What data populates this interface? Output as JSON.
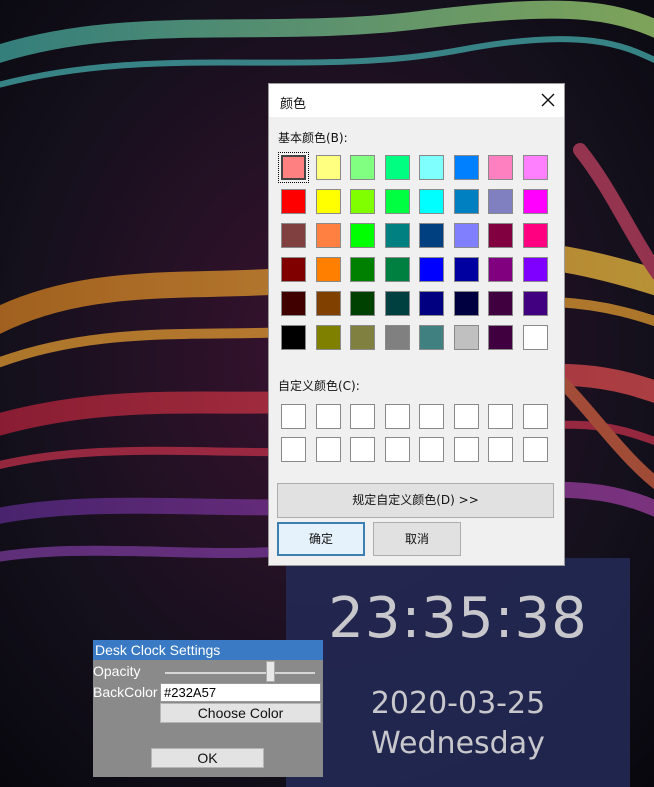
{
  "color_dialog": {
    "title": "颜色",
    "basic_colors_label": "基本颜色(B):",
    "custom_colors_label": "自定义颜色(C):",
    "define_custom_button": "规定自定义颜色(D) >>",
    "ok_button": "确定",
    "cancel_button": "取消",
    "basic_colors": [
      "#ff8080",
      "#ffff80",
      "#80ff80",
      "#00ff80",
      "#80ffff",
      "#0080ff",
      "#ff80c0",
      "#ff80ff",
      "#ff0000",
      "#ffff00",
      "#80ff00",
      "#00ff40",
      "#00ffff",
      "#0080c0",
      "#8080c0",
      "#ff00ff",
      "#804040",
      "#ff8040",
      "#00ff00",
      "#008080",
      "#004080",
      "#8080ff",
      "#800040",
      "#ff0080",
      "#800000",
      "#ff8000",
      "#008000",
      "#008040",
      "#0000ff",
      "#0000a0",
      "#800080",
      "#8000ff",
      "#400000",
      "#804000",
      "#004000",
      "#004040",
      "#000080",
      "#000040",
      "#400040",
      "#400080",
      "#000000",
      "#808000",
      "#808040",
      "#808080",
      "#408080",
      "#c0c0c0",
      "#400040",
      "#ffffff"
    ],
    "selected_index": 0,
    "custom_colors_count": 16
  },
  "clock": {
    "time": "23:35:38",
    "date": "2020-03-25",
    "weekday": "Wednesday",
    "background": "#232A57"
  },
  "settings": {
    "title": "Desk Clock Settings",
    "opacity_label": "Opacity",
    "opacity_value": 0.7,
    "backcolor_label": "BackColor",
    "backcolor_value": "#232A57",
    "choose_color_button": "Choose Color",
    "ok_button": "OK"
  }
}
